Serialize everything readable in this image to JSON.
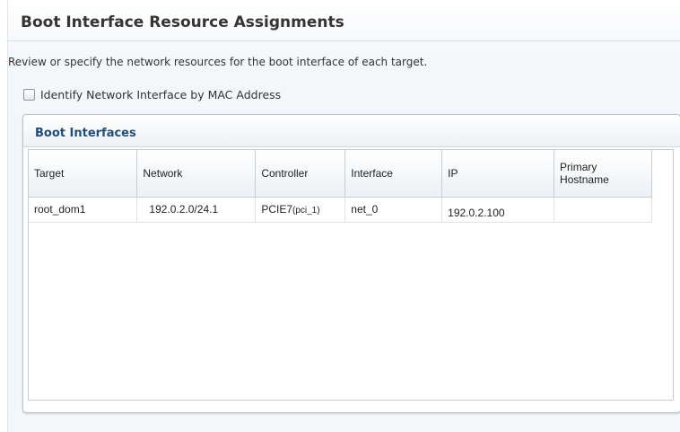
{
  "page": {
    "title": "Boot Interface Resource Assignments",
    "description": "Review or specify the network resources for the boot interface of each target."
  },
  "options": {
    "identify_by_mac_label": "Identify Network Interface by MAC Address",
    "identify_by_mac_checked": false
  },
  "panel": {
    "title": "Boot Interfaces"
  },
  "table": {
    "columns": [
      "Target",
      "Network",
      "Controller",
      "Interface",
      "IP",
      "Primary Hostname"
    ],
    "rows": [
      {
        "target": "root_dom1",
        "network": "192.0.2.0/24.1",
        "controller_main": "PCIE7",
        "controller_sub": "(pci_1)",
        "interface": "net_0",
        "ip": "192.0.2.100",
        "hostname": ""
      }
    ]
  },
  "colors": {
    "panel_title": "#1f4e79",
    "border": "#c5cdd6",
    "background": "#f4f7fa"
  }
}
